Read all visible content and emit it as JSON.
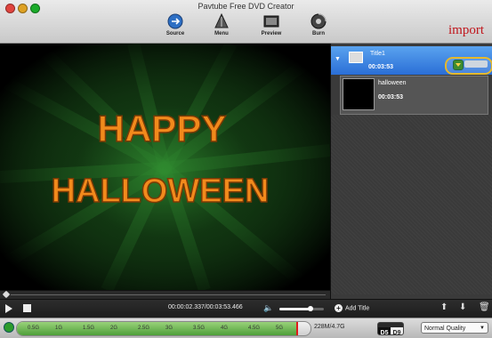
{
  "window": {
    "title": "Pavtube Free DVD Creator"
  },
  "toolbar": {
    "source": "Source",
    "menu": "Menu",
    "preview": "Preview",
    "burn": "Burn"
  },
  "annotation": {
    "import": "import"
  },
  "video": {
    "line1": "HAPPY",
    "line2": "HALLOWEEN"
  },
  "titles": {
    "title_name": "Title1",
    "title_duration": "00:03:53",
    "clip_name": "halloween",
    "clip_duration": "00:03:53"
  },
  "player": {
    "time": "00:00:02.337/00:03:53.466",
    "volume_level": 0.7,
    "add_title": "Add Title"
  },
  "status": {
    "ticks": [
      "0.5G",
      "1G",
      "1.5G",
      "2G",
      "2.5G",
      "3G",
      "3.5G",
      "4G",
      "4.5G",
      "5G"
    ],
    "capacity_fill": 0.95,
    "capacity_text": "228M/4.7G",
    "disc_d5": "D5",
    "disc_d9": "D9",
    "quality": "Normal Quality"
  },
  "colors": {
    "title_text": "#f28a1c",
    "glow": "#3aa23a",
    "highlight": "#2a6ed6",
    "annotation": "#c0151b"
  }
}
